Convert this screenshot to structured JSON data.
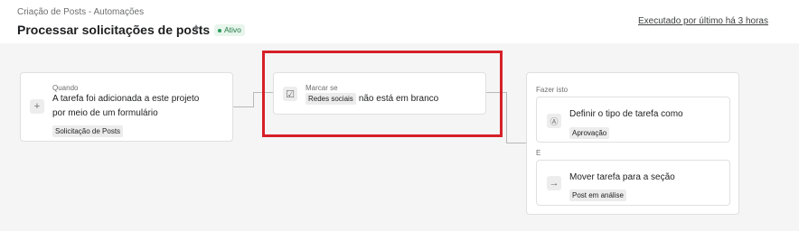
{
  "header": {
    "breadcrumb": "Criação de Posts - Automações",
    "title": "Processar solicitações de posts",
    "status": "Ativo",
    "last_run": "Executado por último há 3 horas",
    "sparkle_icon": "sparkle-icon"
  },
  "trigger": {
    "label": "Quando",
    "text_line1": "A tarefa foi adicionada a este projeto",
    "text_line2": "por meio de um formulário",
    "chip": "Solicitação de Posts",
    "icon": "plus-icon"
  },
  "condition": {
    "label": "Marcar se",
    "chip": "Redes sociais",
    "text": "não está em branco",
    "icon": "checkbox-icon"
  },
  "actions": {
    "label": "Fazer isto",
    "and_label": "E",
    "items": [
      {
        "text": "Definir o tipo de tarefa como",
        "chip": "Aprovação",
        "icon": "letter-a-icon"
      },
      {
        "text": "Mover tarefa para a seção",
        "chip": "Post em análise",
        "icon": "arrow-right-icon"
      }
    ]
  },
  "colors": {
    "highlight": "#d62027",
    "status_green": "#2a9c5a"
  }
}
